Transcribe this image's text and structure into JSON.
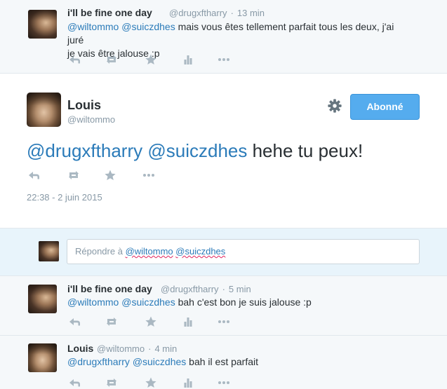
{
  "tweets": {
    "t1": {
      "name": "i'll be fine one day",
      "handle": "@drugxftharry",
      "time": "13 min",
      "mention1": "@wiltommo",
      "mention2": "@suiczdhes",
      "text_line1": " mais vous êtes tellement parfait tous les deux, j'ai juré",
      "text_line2": "je vais être jalouse :p"
    },
    "main": {
      "name": "Louis",
      "handle": "@wiltommo",
      "mention1": "@drugxftharry",
      "mention2": "@suiczdhes",
      "text": " hehe tu peux!",
      "timestamp": "22:38 - 2 juin 2015",
      "follow_label": "Abonné"
    },
    "reply": {
      "prefix": "Répondre à ",
      "mention1": "@wiltommo",
      "mention2": "@suiczdhes"
    },
    "t3": {
      "name": "i'll be fine one day",
      "handle": "@drugxftharry",
      "time": "5 min",
      "mention1": "@wiltommo",
      "mention2": "@suiczdhes",
      "text": " bah c'est bon je suis jalouse :p"
    },
    "t4": {
      "name": "Louis",
      "handle": "@wiltommo",
      "time": "4 min",
      "mention1": "@drugxftharry",
      "mention2": "@suiczdhes",
      "text": " bah il est parfait"
    }
  },
  "meta_separator": "·",
  "icons": [
    "reply-icon",
    "retweet-icon",
    "favorite-icon",
    "analytics-icon",
    "more-icon",
    "gear-icon"
  ],
  "colors": {
    "link": "#2b7bb9",
    "muted": "#8899a6",
    "text": "#292f33",
    "action_icon": "#aab8c2",
    "follow_button": "#55acee",
    "background": "#f5f8fa",
    "reply_area": "#e8f4fb"
  }
}
